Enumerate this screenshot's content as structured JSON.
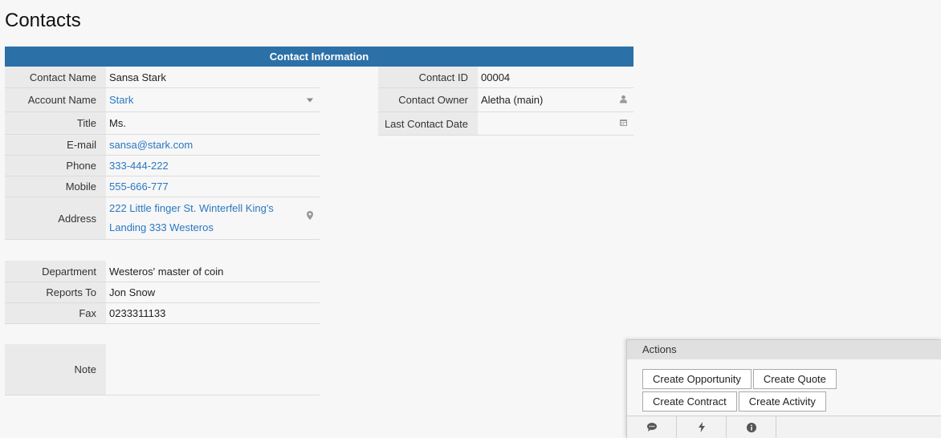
{
  "page": {
    "title": "Contacts"
  },
  "section": {
    "title": "Contact Information"
  },
  "left_fields": [
    {
      "label": "Contact Name",
      "value": "Sansa Stark"
    },
    {
      "label": "Account Name",
      "value": "Stark"
    },
    {
      "label": "Title",
      "value": "Ms."
    },
    {
      "label": "E-mail",
      "value": "sansa@stark.com"
    },
    {
      "label": "Phone",
      "value": "333-444-222"
    },
    {
      "label": "Mobile",
      "value": "555-666-777"
    },
    {
      "label": "Address",
      "value_line1": "222 Little finger St. Winterfell King's",
      "value_line2": "Landing 333 Westeros"
    }
  ],
  "right_fields": [
    {
      "label": "Contact ID",
      "value": "00004"
    },
    {
      "label": "Contact Owner",
      "value": "Aletha (main)"
    },
    {
      "label": "Last Contact Date",
      "value": ""
    }
  ],
  "extra_fields": [
    {
      "label": "Department",
      "value": "Westeros' master of coin"
    },
    {
      "label": "Reports To",
      "value": "Jon Snow"
    },
    {
      "label": "Fax",
      "value": "0233311133"
    }
  ],
  "note": {
    "label": "Note",
    "value": ""
  },
  "actions": {
    "title": "Actions",
    "buttons": [
      "Create Opportunity",
      "Create Quote",
      "Create Contract",
      "Create Activity"
    ]
  },
  "icons": {
    "dropdown": "chevron-down-icon",
    "user": "user-icon",
    "calendar": "calendar-icon",
    "location": "map-marker-icon",
    "comment": "comment-icon",
    "bolt": "bolt-icon",
    "info": "info-icon"
  },
  "colors": {
    "header_bg": "#2c70a8",
    "link": "#2a77c2",
    "label_bg": "#eaeaea"
  }
}
